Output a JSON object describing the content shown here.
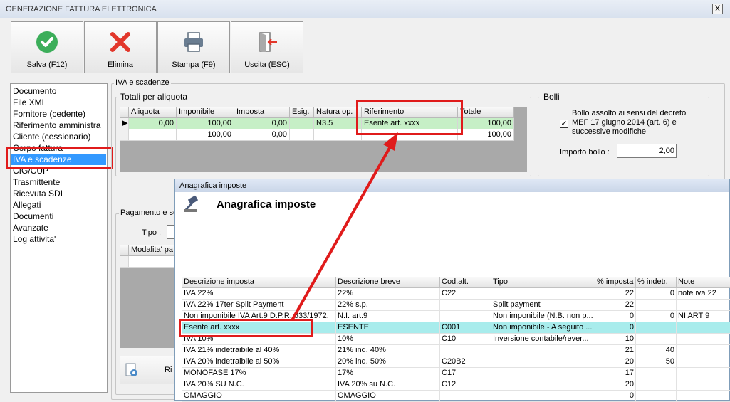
{
  "window": {
    "title": "GENERAZIONE FATTURA ELETTRONICA",
    "close_label": "X"
  },
  "toolbar": {
    "save_label": "Salva (F12)",
    "delete_label": "Elimina",
    "print_label": "Stampa (F9)",
    "exit_label": "Uscita (ESC)"
  },
  "nav": {
    "items": [
      "Documento",
      "File XML",
      "Fornitore (cedente)",
      "Riferimento amministra",
      "Cliente (cessionario)",
      "Corpo fattura",
      "IVA e scadenze",
      "CIG/CUP",
      "Trasmittente",
      "Ricevuta SDI",
      "Allegati",
      "Documenti",
      "Avanzate",
      "Log attivita'"
    ],
    "selected": "IVA e scadenze"
  },
  "iva": {
    "group_label": "IVA e scadenze",
    "totals_label": "Totali per aliquota",
    "columns": [
      "Aliquota",
      "Imponibile",
      "Imposta",
      "Esig.",
      "Natura op.",
      "Riferimento",
      "Totale"
    ],
    "rows": [
      [
        "0,00",
        "100,00",
        "0,00",
        "",
        "N3.5",
        "Esente art. xxxx",
        "100,00"
      ],
      [
        "",
        "100,00",
        "0,00",
        "",
        "",
        "",
        "100,00"
      ]
    ]
  },
  "bolli": {
    "label": "Bolli",
    "checkbox_text": "Bollo assolto ai sensi del decreto MEF 17 giugno 2014 (art. 6) e successive modifiche",
    "checked": true,
    "importo_label": "Importo bollo :",
    "importo_value": "2,00"
  },
  "pagamento": {
    "label": "Pagamento e sc",
    "tipo_label": "Tipo :",
    "col_modalita": "Modalita' pa",
    "riepilogo_fragment": "Ri"
  },
  "popup": {
    "window_title": "Anagrafica imposte",
    "heading": "Anagrafica imposte",
    "columns": [
      "Descrizione imposta",
      "Descrizione breve",
      "Cod.alt.",
      "Tipo",
      "% imposta",
      "% indetr.",
      "Note"
    ],
    "rows": [
      [
        "IVA 22%",
        "22%",
        "C22",
        "",
        "22",
        "0",
        "note iva 22"
      ],
      [
        "IVA 22% 17ter Split Payment",
        "22% s.p.",
        "",
        "Split payment",
        "22",
        "",
        ""
      ],
      [
        "Non imponibile IVA Art.9 D.P.R. 633/1972.",
        "N.I. art.9",
        "",
        "Non imponibile (N.B. non p...",
        "0",
        "0",
        "NI ART 9"
      ],
      [
        "Esente art. xxxx",
        "ESENTE",
        "C001",
        "Non imponibile - A seguito ...",
        "0",
        "",
        ""
      ],
      [
        "IVA 10%",
        "10%",
        "C10",
        "Inversione contabile/rever...",
        "10",
        "",
        ""
      ],
      [
        "IVA 21% indetraibile al 40%",
        "21% ind. 40%",
        "",
        "",
        "21",
        "40",
        ""
      ],
      [
        "IVA 20% indetraibile al 50%",
        "20% ind. 50%",
        "C20B2",
        "",
        "20",
        "50",
        ""
      ],
      [
        "MONOFASE 17%",
        "17%",
        "C17",
        "",
        "17",
        "",
        ""
      ],
      [
        "IVA 20% SU N.C.",
        "IVA 20% su N.C.",
        "C12",
        "",
        "20",
        "",
        ""
      ],
      [
        "OMAGGIO",
        "OMAGGIO",
        "",
        "",
        "0",
        "",
        ""
      ]
    ],
    "selected_row": 3
  },
  "colors": {
    "selection": "#3399ff",
    "grid_highlight": "#c6efc6",
    "popup_highlight": "#a8ecec",
    "annotation": "#e01b1b"
  }
}
